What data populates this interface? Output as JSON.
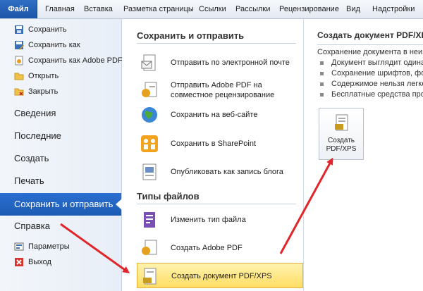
{
  "ribbon": {
    "file_tab": "Файл",
    "tabs": [
      "Главная",
      "Вставка",
      "Разметка страницы",
      "Ссылки",
      "Рассылки",
      "Рецензирование",
      "Вид",
      "Надстройки"
    ]
  },
  "left_nav": {
    "commands": [
      {
        "label": "Сохранить",
        "icon": "save-icon"
      },
      {
        "label": "Сохранить как",
        "icon": "save-as-icon"
      },
      {
        "label": "Сохранить как Adobe PDF",
        "icon": "save-as-pdf-icon"
      },
      {
        "label": "Открыть",
        "icon": "open-folder-icon"
      },
      {
        "label": "Закрыть",
        "icon": "close-folder-icon"
      }
    ],
    "items": [
      "Сведения",
      "Последние",
      "Создать",
      "Печать",
      "Сохранить и отправить",
      "Справка"
    ],
    "active_item": "Сохранить и отправить",
    "footer": [
      {
        "label": "Параметры",
        "icon": "options-icon"
      },
      {
        "label": "Выход",
        "icon": "exit-icon"
      }
    ]
  },
  "middle": {
    "save_send_title": "Сохранить и отправить",
    "save_send_options": [
      {
        "label": "Отправить по электронной почте",
        "icon": "email-icon"
      },
      {
        "label": "Отправить Adobe PDF на совместное рецензирование",
        "icon": "pdf-review-icon"
      },
      {
        "label": "Сохранить на веб-сайте",
        "icon": "globe-icon"
      },
      {
        "label": "Сохранить в SharePoint",
        "icon": "sharepoint-icon"
      },
      {
        "label": "Опубликовать как запись блога",
        "icon": "blog-icon"
      }
    ],
    "file_types_title": "Типы файлов",
    "file_type_options": [
      {
        "label": "Изменить тип файла",
        "icon": "change-file-type-icon"
      },
      {
        "label": "Создать Adobe PDF",
        "icon": "adobe-pdf-icon"
      },
      {
        "label": "Создать документ PDF/XPS",
        "icon": "pdf-xps-icon",
        "selected": true
      }
    ]
  },
  "right": {
    "title": "Создать документ PDF/XPS",
    "intro": "Сохранение документа в неизме",
    "bullets": [
      "Документ выглядит одинако",
      "Сохранение шрифтов, форм",
      "Содержимое нельзя легко и",
      "Бесплатные средства просм"
    ],
    "button_label": "Создать\nPDF/XPS"
  },
  "colors": {
    "file_tab": "#1b54a8",
    "active_nav": "#1d5bb4",
    "selected_option": "#ffdd63",
    "annotation_arrow": "#e0252b"
  }
}
